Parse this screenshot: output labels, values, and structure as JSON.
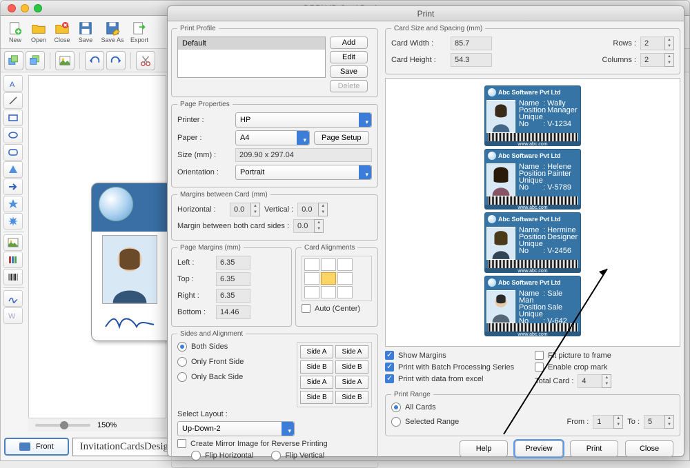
{
  "window": {
    "title": "DRPU ID Card Designer"
  },
  "toolbar": {
    "new": "New",
    "open": "Open",
    "close": "Close",
    "save": "Save",
    "save_as": "Save As",
    "export": "Export"
  },
  "zoom": "150%",
  "front_button": "Front",
  "watermark": "InvitationCardsDesigningSoftware.com",
  "print": {
    "title": "Print",
    "profile": {
      "legend": "Print Profile",
      "selected": "Default",
      "add": "Add",
      "edit": "Edit",
      "save": "Save",
      "delete": "Delete"
    },
    "page": {
      "legend": "Page Properties",
      "printer_label": "Printer :",
      "printer": "HP",
      "paper_label": "Paper :",
      "paper": "A4",
      "page_setup": "Page Setup",
      "size_label": "Size (mm) :",
      "size": "209.90 x 297.04",
      "orientation_label": "Orientation :",
      "orientation": "Portrait"
    },
    "margins_card": {
      "legend": "Margins between Card (mm)",
      "horizontal_label": "Horizontal :",
      "horizontal": "0.0",
      "vertical_label": "Vertical :",
      "vertical": "0.0",
      "both_sides_label": "Margin between both card sides :",
      "both_sides": "0.0"
    },
    "page_margins": {
      "legend": "Page Margins (mm)",
      "left_label": "Left :",
      "left": "6.35",
      "top_label": "Top :",
      "top": "6.35",
      "right_label": "Right :",
      "right": "6.35",
      "bottom_label": "Bottom :",
      "bottom": "14.46"
    },
    "alignments": {
      "legend": "Card Alignments",
      "auto": "Auto (Center)"
    },
    "sides": {
      "legend": "Sides and Alignment",
      "both": "Both Sides",
      "front": "Only Front Side",
      "back": "Only Back Side",
      "select_layout_label": "Select Layout :",
      "layout": "Up-Down-2",
      "mirror": "Create Mirror Image for Reverse Printing",
      "flip_h": "Flip Horizontal",
      "flip_v": "Flip Vertical",
      "side_a": "Side A",
      "side_b": "Side B"
    },
    "card_size": {
      "legend": "Card Size and Spacing (mm)",
      "width_label": "Card Width :",
      "width": "85.7",
      "height_label": "Card Height :",
      "height": "54.3",
      "rows_label": "Rows :",
      "rows": "2",
      "cols_label": "Columns :",
      "cols": "2"
    },
    "options": {
      "show_margins": "Show Margins",
      "batch": "Print with Batch Processing Series",
      "excel": "Print with data from excel",
      "fit": "Fit picture to frame",
      "crop": "Enable crop mark",
      "total_label": "Total Card :",
      "total": "4"
    },
    "range": {
      "legend": "Print Range",
      "all": "All Cards",
      "selected": "Selected Range",
      "from_label": "From :",
      "from": "1",
      "to_label": "To :",
      "to": "5"
    },
    "buttons": {
      "help": "Help",
      "preview": "Preview",
      "print": "Print",
      "close": "Close"
    },
    "preview_cards": [
      {
        "company": "Abc Software Pvt Ltd",
        "name": "Wally",
        "position": "Manager",
        "uid": "V-1234",
        "url": "www.abc.com"
      },
      {
        "company": "Abc Software Pvt Ltd",
        "name": "Helene",
        "position": "Painter",
        "uid": "V-5789",
        "url": "www.abc.com"
      },
      {
        "company": "Abc Software Pvt Ltd",
        "name": "Hermine",
        "position": "Designer",
        "uid": "V-2456",
        "url": "www.abc.com"
      },
      {
        "company": "Abc Software Pvt Ltd",
        "name": "Sale Man",
        "position": "Sale",
        "uid": "V-642",
        "url": "www.abc.com"
      }
    ],
    "card_labels": {
      "name": "Name",
      "position": "Position",
      "uid": "Unique No"
    }
  }
}
